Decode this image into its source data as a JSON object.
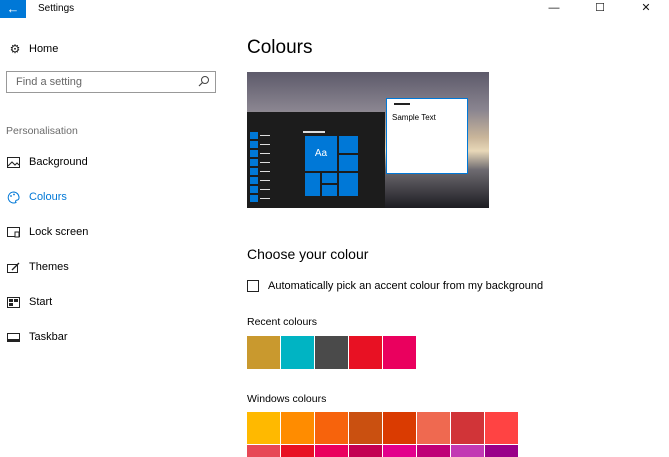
{
  "window": {
    "title": "Settings",
    "minimize_glyph": "—",
    "maximize_glyph": "☐",
    "close_glyph": "✕",
    "accent": "#0078d7"
  },
  "sidebar": {
    "home_label": "Home",
    "search_placeholder": "Find a setting",
    "section_label": "Personalisation",
    "items": [
      {
        "label": "Background",
        "icon": "picture-icon"
      },
      {
        "label": "Colours",
        "icon": "palette-icon",
        "active": true
      },
      {
        "label": "Lock screen",
        "icon": "lock-screen-icon"
      },
      {
        "label": "Themes",
        "icon": "themes-icon"
      },
      {
        "label": "Start",
        "icon": "start-icon"
      },
      {
        "label": "Taskbar",
        "icon": "taskbar-icon"
      }
    ]
  },
  "main": {
    "title": "Colours",
    "preview": {
      "tile_text": "Aa",
      "sample_text": "Sample Text"
    },
    "choose_title": "Choose your colour",
    "auto_pick_label": "Automatically pick an accent colour from my background",
    "auto_pick_checked": false,
    "recent_label": "Recent colours",
    "recent_colours": [
      "#c9992e",
      "#00b4c3",
      "#4a4a4a",
      "#e81123",
      "#ea005e"
    ],
    "windows_label": "Windows colours",
    "windows_colours": [
      [
        "#ffb900",
        "#ff8c00",
        "#f7630c",
        "#ca5010",
        "#da3b01",
        "#ef6950",
        "#d13438",
        "#ff4343"
      ],
      [
        "#e74856",
        "#e81123",
        "#ea005e",
        "#c30052",
        "#e3008c",
        "#bf0077",
        "#c239b3",
        "#9a0089"
      ]
    ]
  }
}
